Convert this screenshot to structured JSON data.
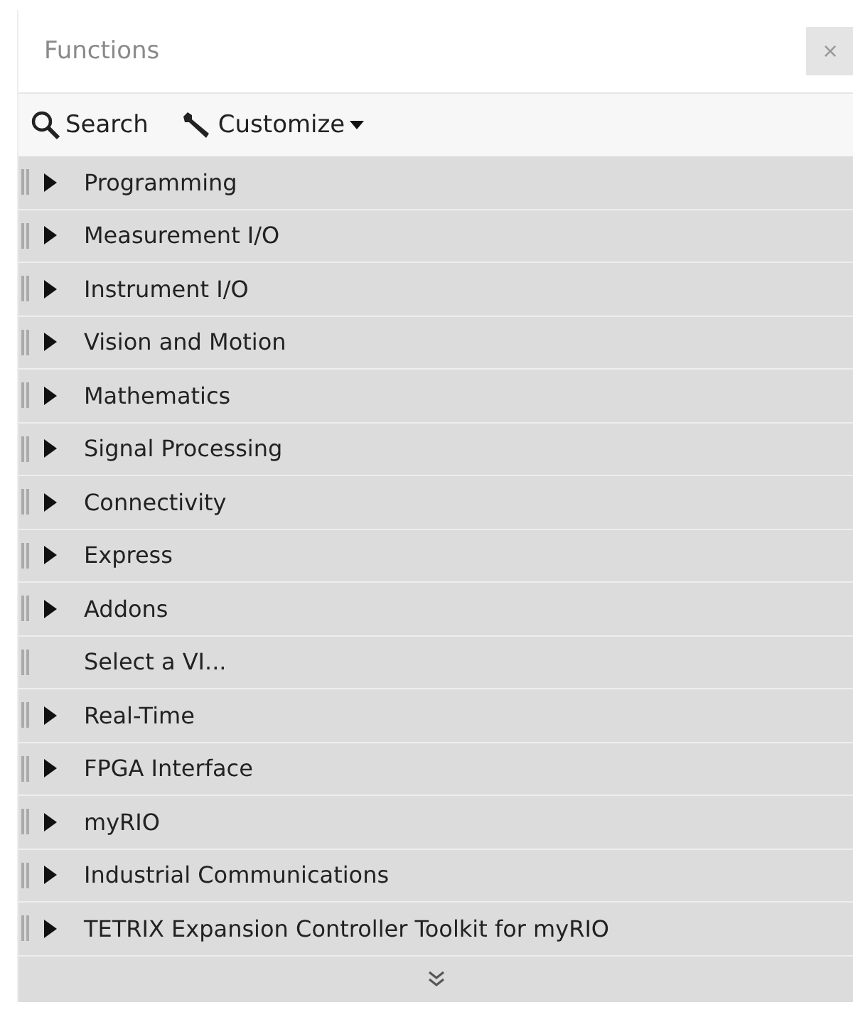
{
  "window": {
    "title": "Functions",
    "close": "×"
  },
  "toolbar": [
    {
      "kind": "search",
      "label": "Search"
    },
    {
      "kind": "customize",
      "label": "Customize"
    }
  ],
  "items": [
    {
      "label": "Programming",
      "kind": "folder"
    },
    {
      "label": "Measurement I/O",
      "kind": "folder"
    },
    {
      "label": "Instrument I/O",
      "kind": "folder"
    },
    {
      "label": "Vision and Motion",
      "kind": "folder"
    },
    {
      "label": "Mathematics",
      "kind": "folder"
    },
    {
      "label": "Signal Processing",
      "kind": "folder"
    },
    {
      "label": "Connectivity",
      "kind": "folder"
    },
    {
      "label": "Express",
      "kind": "folder"
    },
    {
      "label": "Addons",
      "kind": "folder"
    },
    {
      "label": "Select a VI...",
      "kind": "action"
    },
    {
      "label": "Real-Time",
      "kind": "folder"
    },
    {
      "label": "FPGA Interface",
      "kind": "folder"
    },
    {
      "label": "myRIO",
      "kind": "folder"
    },
    {
      "label": "Industrial Communications",
      "kind": "folder"
    },
    {
      "label": "TETRIX Expansion Controller Toolkit for myRIO",
      "kind": "folder"
    }
  ]
}
